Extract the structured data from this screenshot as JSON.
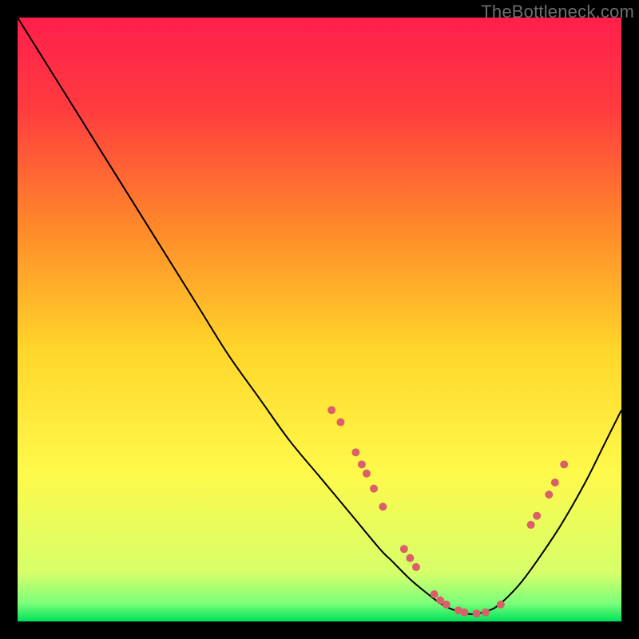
{
  "watermark": "TheBottleneck.com",
  "chart_data": {
    "type": "line",
    "title": "",
    "xlabel": "",
    "ylabel": "",
    "xlim": [
      0,
      100
    ],
    "ylim": [
      0,
      100
    ],
    "grid": false,
    "background_gradient": {
      "stops": [
        {
          "offset": 0.0,
          "color": "#ff1f4b"
        },
        {
          "offset": 0.15,
          "color": "#ff3b3f"
        },
        {
          "offset": 0.35,
          "color": "#ff8a2a"
        },
        {
          "offset": 0.55,
          "color": "#ffd62a"
        },
        {
          "offset": 0.75,
          "color": "#fff94a"
        },
        {
          "offset": 0.92,
          "color": "#d6ff6a"
        },
        {
          "offset": 0.97,
          "color": "#7bff7b"
        },
        {
          "offset": 1.0,
          "color": "#00e05a"
        }
      ]
    },
    "series": [
      {
        "name": "bottleneck-curve",
        "color": "#000000",
        "x": [
          0,
          5,
          10,
          15,
          20,
          25,
          30,
          35,
          40,
          45,
          50,
          55,
          60,
          62,
          65,
          68,
          70,
          72,
          75,
          78,
          80,
          83,
          86,
          90,
          94,
          97,
          100
        ],
        "y": [
          100,
          92,
          84,
          76,
          68,
          60,
          52,
          44,
          37,
          30,
          24,
          18,
          12,
          10,
          7,
          4.5,
          3,
          2,
          1.2,
          1.8,
          3,
          6,
          10,
          16,
          23,
          29,
          35
        ]
      }
    ],
    "scatter": [
      {
        "name": "curve-markers",
        "color": "#d9606a",
        "radius": 5,
        "points": [
          {
            "x": 52,
            "y": 35
          },
          {
            "x": 53.5,
            "y": 33
          },
          {
            "x": 56,
            "y": 28
          },
          {
            "x": 57,
            "y": 26
          },
          {
            "x": 57.8,
            "y": 24.5
          },
          {
            "x": 59,
            "y": 22
          },
          {
            "x": 60.5,
            "y": 19
          },
          {
            "x": 64,
            "y": 12
          },
          {
            "x": 65,
            "y": 10.5
          },
          {
            "x": 66,
            "y": 9
          },
          {
            "x": 69,
            "y": 4.5
          },
          {
            "x": 70,
            "y": 3.5
          },
          {
            "x": 71,
            "y": 2.8
          },
          {
            "x": 73,
            "y": 1.8
          },
          {
            "x": 74,
            "y": 1.5
          },
          {
            "x": 76,
            "y": 1.3
          },
          {
            "x": 77.5,
            "y": 1.5
          },
          {
            "x": 80,
            "y": 2.8
          },
          {
            "x": 85,
            "y": 16
          },
          {
            "x": 86,
            "y": 17.5
          },
          {
            "x": 88,
            "y": 21
          },
          {
            "x": 89,
            "y": 23
          },
          {
            "x": 90.5,
            "y": 26
          }
        ]
      }
    ]
  }
}
